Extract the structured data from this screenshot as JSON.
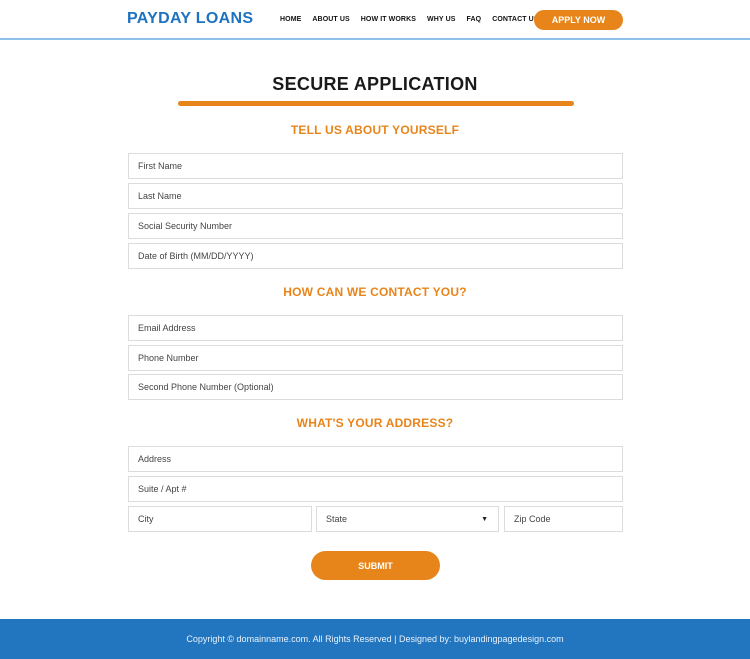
{
  "header": {
    "logo": "PAYDAY LOANS",
    "nav": [
      "HOME",
      "ABOUT US",
      "HOW IT WORKS",
      "WHY US",
      "FAQ",
      "CONTACT US"
    ],
    "cta": "APPLY NOW"
  },
  "main": {
    "title": "SECURE APPLICATION",
    "sections": [
      {
        "heading": "TELL US ABOUT YOURSELF",
        "fields": [
          "First Name",
          "Last Name",
          "Social Security Number",
          "Date of Birth (MM/DD/YYYY)"
        ]
      },
      {
        "heading": "HOW CAN WE CONTACT YOU?",
        "fields": [
          "Email Address",
          "Phone Number",
          "Second Phone Number (Optional)"
        ]
      },
      {
        "heading": "WHAT'S YOUR ADDRESS?",
        "fields": [
          "Address",
          "Suite / Apt #",
          "City",
          "State",
          "Zip Code"
        ]
      }
    ],
    "submit": "SUBMIT"
  },
  "footer": {
    "text": "Copyright © domainname.com. All Rights Reserved  |  Designed by: buylandingpagedesign.com"
  },
  "colors": {
    "brand_blue": "#1f72c0",
    "accent_orange": "#e8851a",
    "footer_blue": "#2276c0"
  }
}
